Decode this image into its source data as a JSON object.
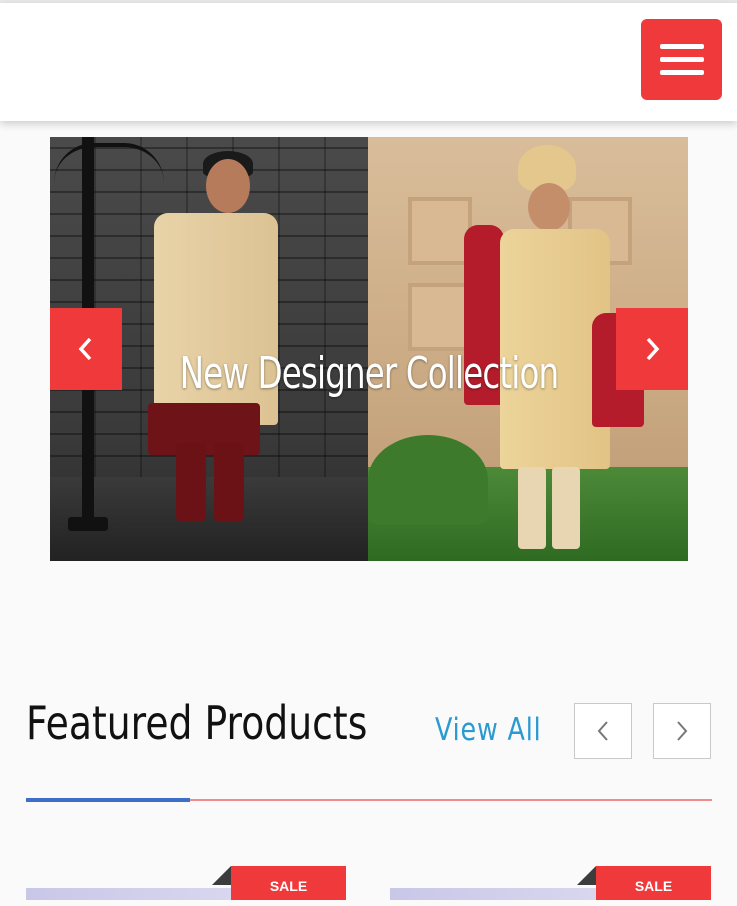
{
  "header": {
    "menu_icon": "hamburger-menu-icon",
    "accent_color": "#f0393a"
  },
  "slider": {
    "caption": "New Designer Collection",
    "prev_icon": "chevron-left-icon",
    "next_icon": "chevron-right-icon"
  },
  "featured": {
    "title": "Featured Products",
    "view_all": "View All",
    "prev_icon": "chevron-left-icon",
    "next_icon": "chevron-right-icon",
    "accent_color": "#3d6ec9",
    "link_color": "#2b9ad1"
  },
  "products": [
    {
      "badge": "SALE"
    },
    {
      "badge": "SALE"
    }
  ]
}
